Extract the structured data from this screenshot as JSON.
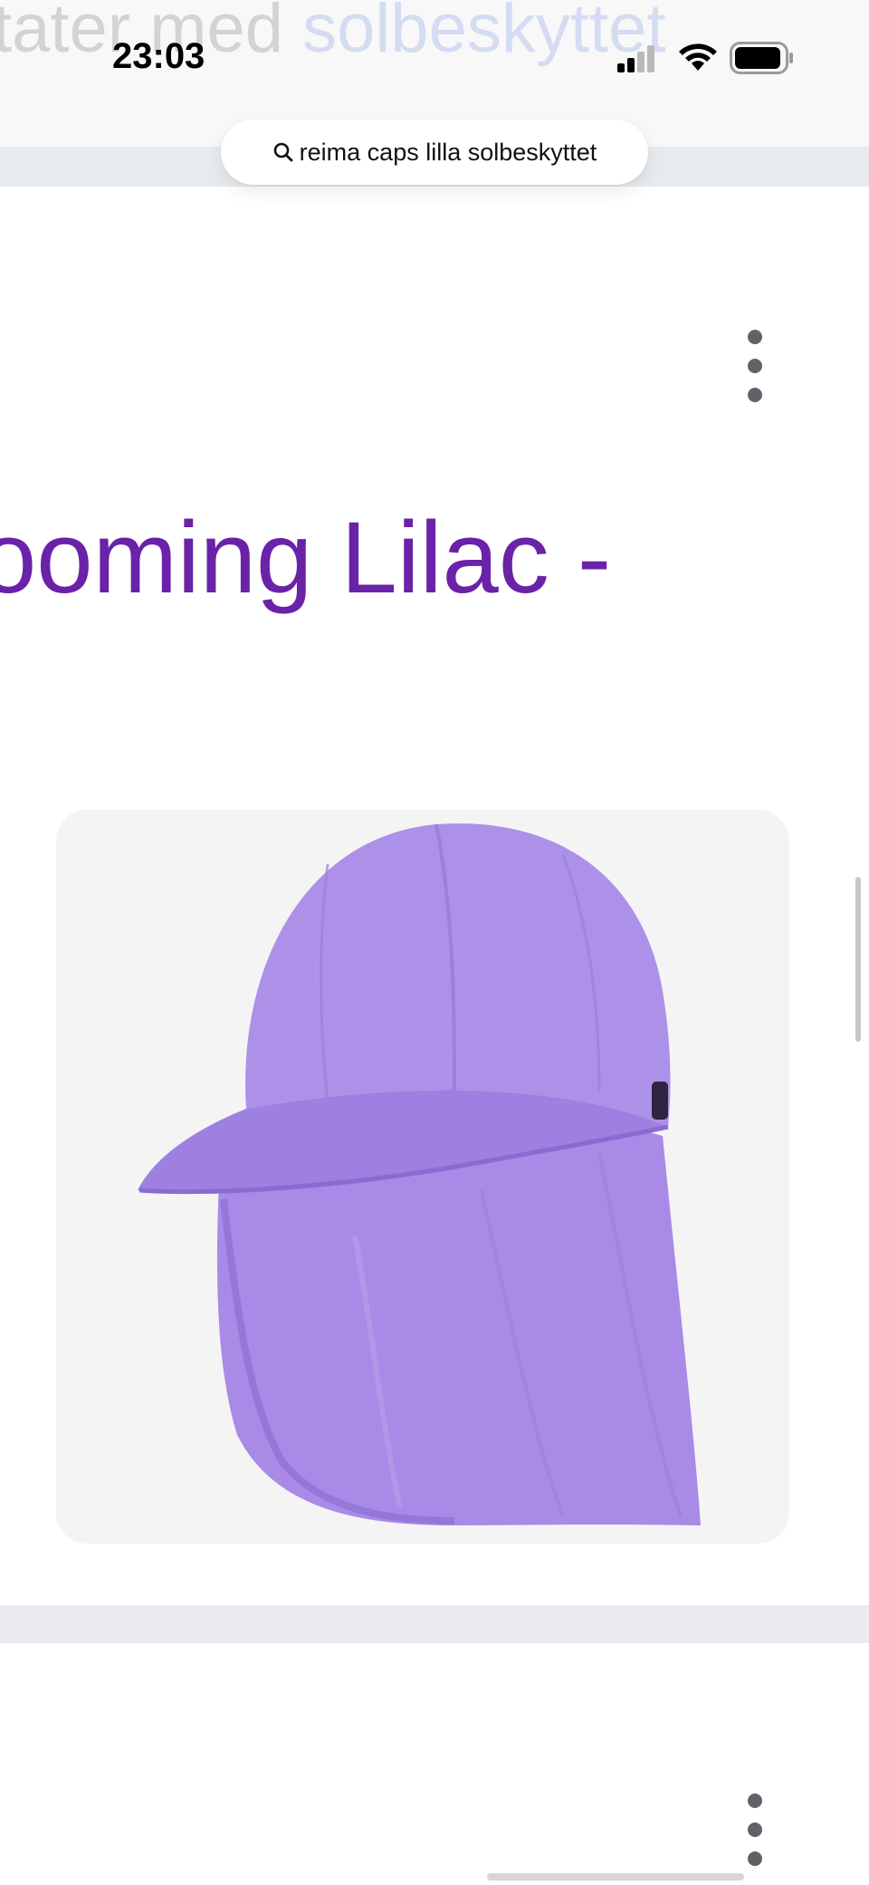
{
  "status_bar": {
    "time": "23:03"
  },
  "background_heading": {
    "part1": "tater med ",
    "part2": "solbeskyttet"
  },
  "search": {
    "query": "reima caps lilla solbeskyttet"
  },
  "result": {
    "title": "ooming Lilac -"
  },
  "colors": {
    "title": "#6a22a8",
    "cap": "#a98ae6",
    "cap_shadow": "#9578d8",
    "card_bg": "#f4f4f5"
  },
  "icons": {
    "search": "magnifier-icon",
    "more": "vertical-ellipsis-icon",
    "signal": "cellular-signal-icon",
    "wifi": "wifi-icon",
    "battery": "battery-icon"
  }
}
